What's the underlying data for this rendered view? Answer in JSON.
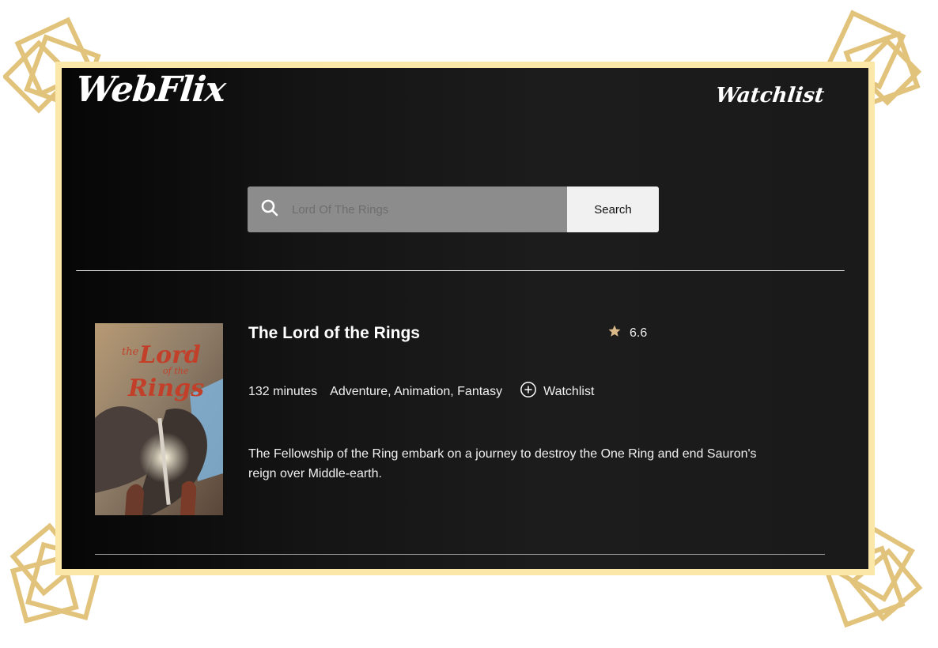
{
  "app": {
    "logo": "WebFlix",
    "nav_watchlist": "Watchlist"
  },
  "search": {
    "placeholder": "Lord Of The Rings",
    "button_label": "Search"
  },
  "movie": {
    "title": "The Lord of the Rings",
    "rating": "6.6",
    "runtime": "132 minutes",
    "genres": "Adventure, Animation, Fantasy",
    "watchlist_label": "Watchlist",
    "plot": "The Fellowship of the Ring embark on a journey to destroy the One Ring and end Sauron's reign over Middle-earth."
  },
  "poster_text": {
    "line1": "the",
    "line2": "Lord",
    "line3": "of the",
    "line4": "Rings"
  },
  "colors": {
    "frame": "#fbe7a8",
    "decor": "#e2c37c",
    "star": "#d9b98a",
    "screen": "#141414"
  },
  "icons": {
    "search": "search-icon",
    "star": "star-icon",
    "add": "plus-circle-icon"
  }
}
